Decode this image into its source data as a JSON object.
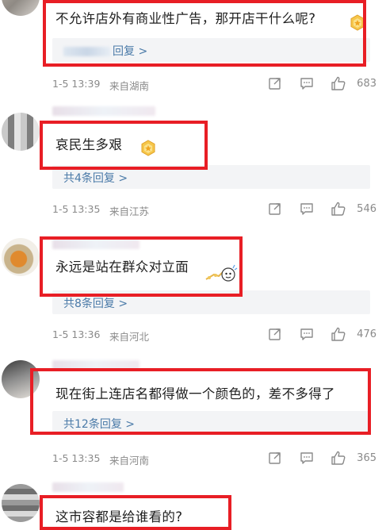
{
  "comments": [
    {
      "text": "不允许店外有商业性广告，那开店干什么呢?",
      "reply_link": "回复 >",
      "time": "1-5 13:39",
      "location": "来自湖南",
      "likes": "683"
    },
    {
      "text": "哀民生多艰",
      "reply_link": "共4条回复 >",
      "time": "1-5 13:35",
      "location": "来自江苏",
      "likes": "546"
    },
    {
      "text": "永远是站在群众对立面",
      "reply_link": "共8条回复 >",
      "time": "1-5 13:36",
      "location": "来自河北",
      "likes": "476"
    },
    {
      "text": "现在街上连店名都得做一个颜色的，差不多得了",
      "reply_link": "共12条回复 >",
      "time": "1-5 13:35",
      "location": "来自河南",
      "likes": "365"
    },
    {
      "text": "这市容都是给谁看的?"
    }
  ],
  "colors": {
    "highlight_border": "#e81e25",
    "link": "#4a7aa8",
    "meta": "#8a8a8a",
    "reply_bg": "#f3f4f6"
  },
  "icons": {
    "share": "share-icon",
    "comment": "comment-icon",
    "like": "thumbs-up-icon",
    "badge": "gold-badge-icon"
  }
}
